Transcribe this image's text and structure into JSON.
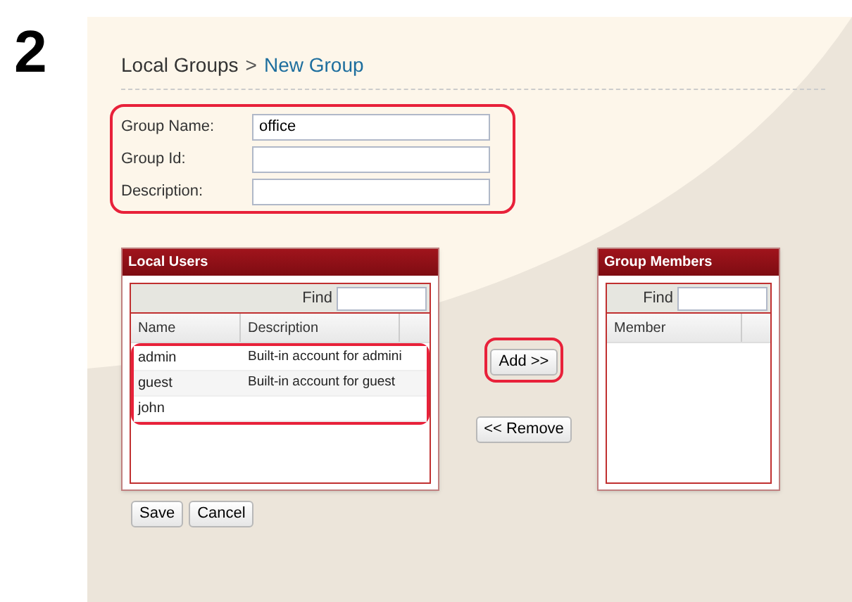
{
  "step": "2",
  "breadcrumb": {
    "parent": "Local Groups",
    "separator": ">",
    "current": "New Group"
  },
  "form": {
    "highlighted": true,
    "fields": [
      {
        "label": "Group Name:",
        "value": "office"
      },
      {
        "label": "Group Id:"
      },
      {
        "label": "Description:"
      }
    ]
  },
  "local_users": {
    "title": "Local Users",
    "find_label": "Find",
    "columns": [
      "Name",
      "Description"
    ],
    "rows_highlighted": true,
    "rows": [
      {
        "name": "admin",
        "description": "Built-in account for admini"
      },
      {
        "name": "guest",
        "description": "Built-in account for guest"
      },
      {
        "name": "john"
      }
    ]
  },
  "add_button": {
    "label": "Add >>",
    "highlighted": true
  },
  "remove_button": {
    "label": "<< Remove"
  },
  "group_members": {
    "title": "Group Members",
    "find_label": "Find",
    "columns": [
      "Member"
    ]
  },
  "buttons": [
    "Save",
    "Cancel"
  ]
}
